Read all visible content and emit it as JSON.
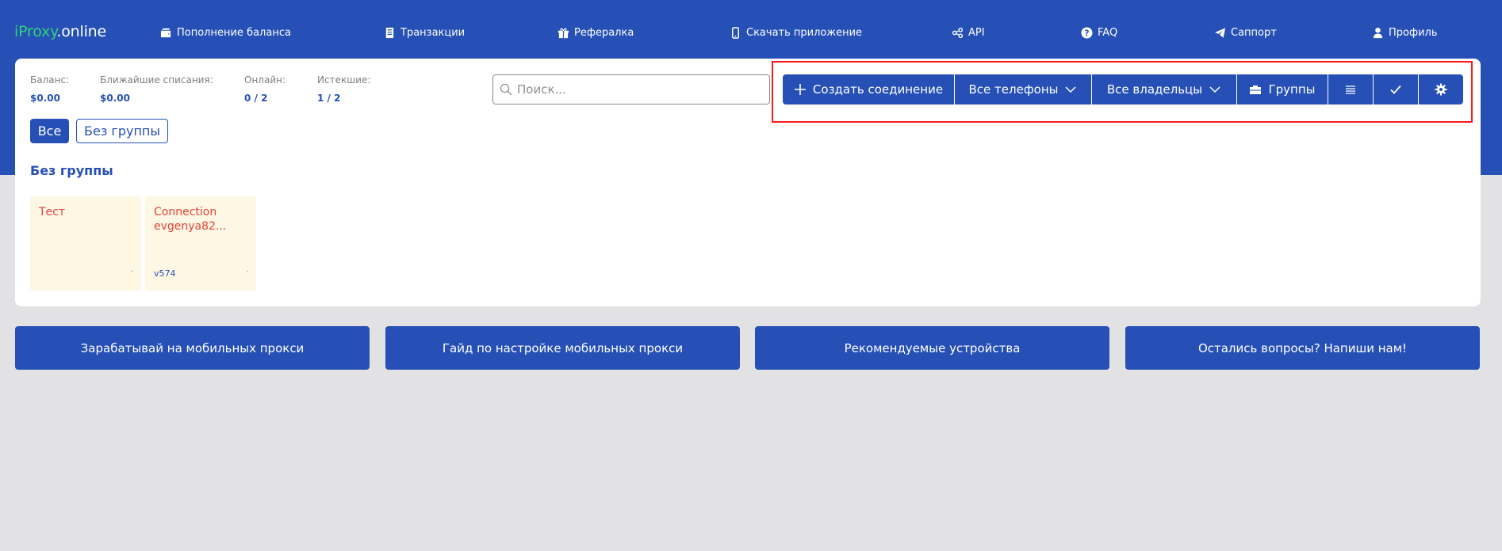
{
  "logo": {
    "brand": "iProxy",
    "suffix": ".online"
  },
  "nav": [
    {
      "label": "Пополнение баланса",
      "icon": "wallet-icon"
    },
    {
      "label": "Транзакции",
      "icon": "document-icon"
    },
    {
      "label": "Рефералка",
      "icon": "gift-icon"
    },
    {
      "label": "Скачать приложение",
      "icon": "phone-icon"
    },
    {
      "label": "API",
      "icon": "api-icon"
    },
    {
      "label": "FAQ",
      "icon": "question-icon"
    },
    {
      "label": "Саппорт",
      "icon": "telegram-icon"
    },
    {
      "label": "Профиль",
      "icon": "user-icon"
    }
  ],
  "stats": {
    "balance": {
      "label": "Баланс:",
      "value": "$0.00"
    },
    "next_charges": {
      "label": "Ближайшие списания:",
      "value": "$0.00"
    },
    "online": {
      "label": "Онлайн:",
      "value": "0 / 2"
    },
    "expired": {
      "label": "Истекшие:",
      "value": "1 / 2"
    }
  },
  "search": {
    "placeholder": "Поиск..."
  },
  "toolbar": {
    "create_label": "Создать соединение",
    "phones_label": "Все телефоны",
    "owners_label": "Все владельцы",
    "groups_label": "Группы",
    "list_icon": "list-icon",
    "check_icon": "check-icon",
    "settings_icon": "gear-icon"
  },
  "filters": {
    "all_label": "Все",
    "no_group_label": "Без группы"
  },
  "group": {
    "title": "Без группы"
  },
  "connections": [
    {
      "name": "Тест",
      "version": ""
    },
    {
      "name": "Connection evgenya82...",
      "version": "v574"
    }
  ],
  "bottom_buttons": [
    "Зарабатывай на мобильных прокси",
    "Гайд по настройке мобильных прокси",
    "Рекомендуемые устройства",
    "Остались вопросы? Напиши нам!"
  ],
  "colors": {
    "primary": "#2650b5",
    "logo_accent": "#2fd17a",
    "highlight": "#ff1a1a",
    "tile_bg": "#fdf7e3",
    "tile_text": "#e8433a",
    "page_bg": "#e2e2e4"
  }
}
